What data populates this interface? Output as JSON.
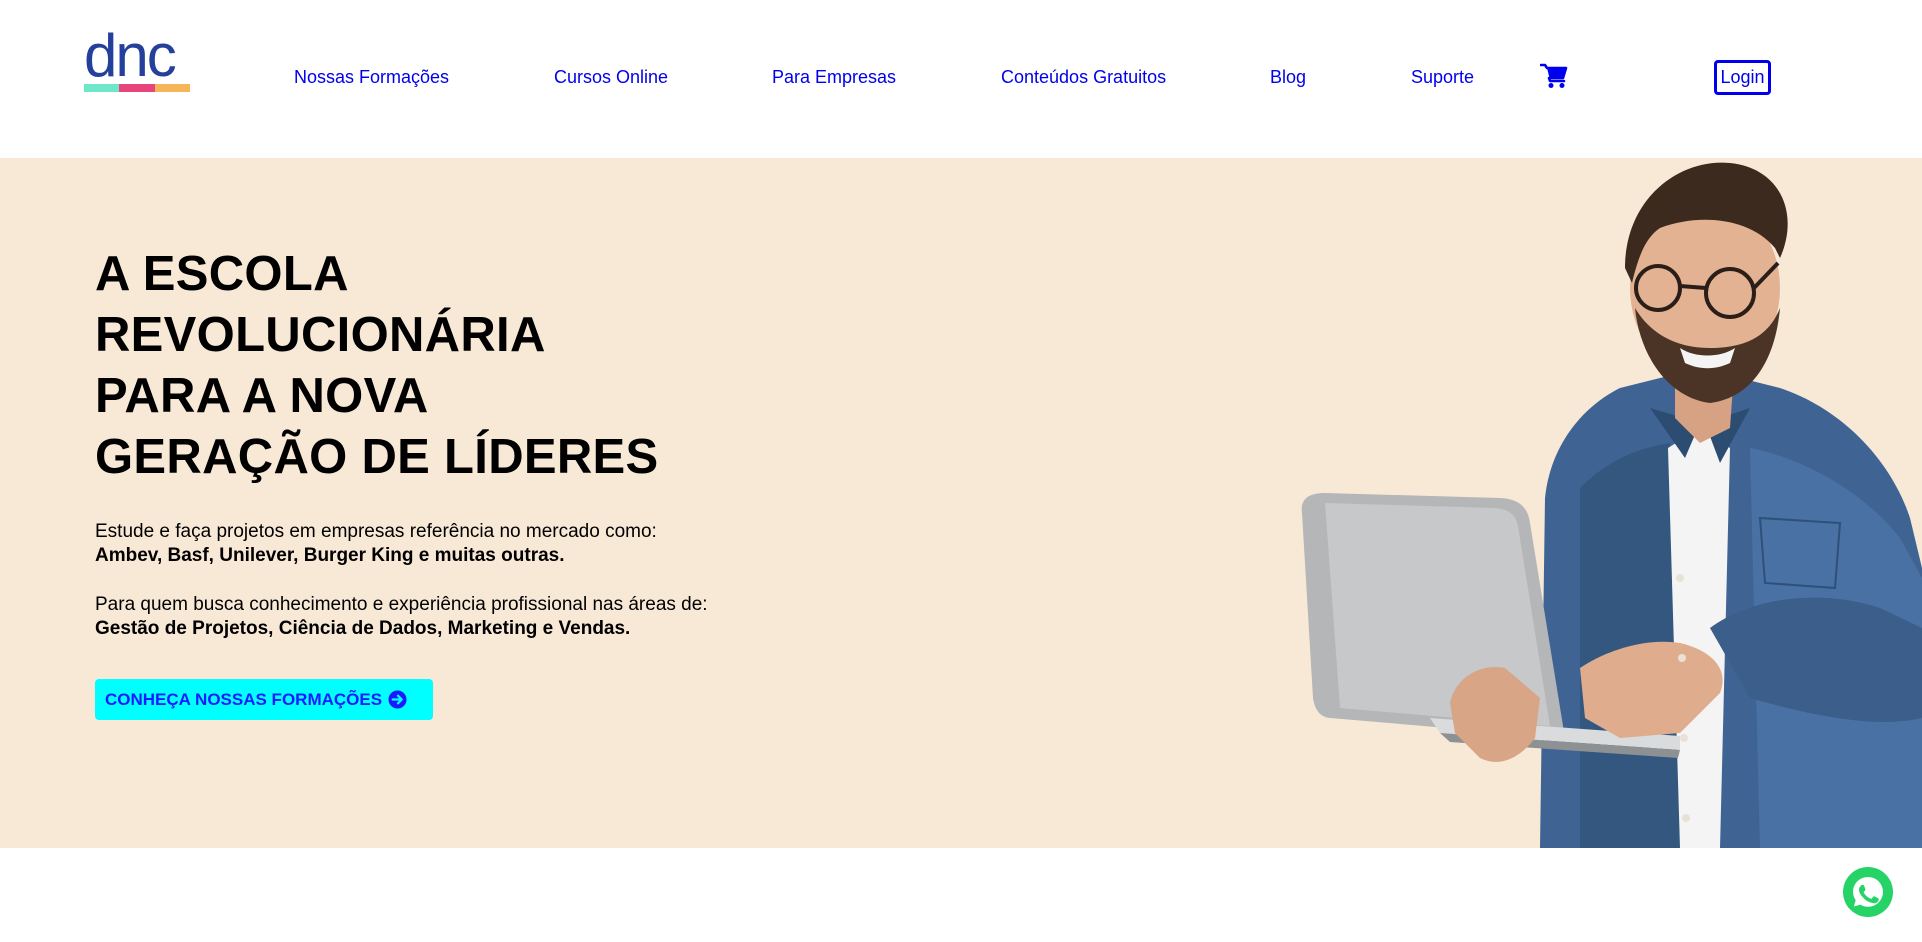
{
  "brand": {
    "logo_text": "dnc",
    "logo_color": "#24409b",
    "logo_bar_colors": [
      "#6ee7c8",
      "#e8457c",
      "#f7b55a"
    ]
  },
  "nav": {
    "items": [
      {
        "label": "Nossas Formações"
      },
      {
        "label": "Cursos Online"
      },
      {
        "label": "Para Empresas"
      },
      {
        "label": "Conteúdos Gratuitos"
      },
      {
        "label": "Blog"
      },
      {
        "label": "Suporte"
      }
    ],
    "cart_icon": "shopping-cart-icon",
    "login_label": "Login",
    "link_color": "#0000ee"
  },
  "hero": {
    "background": "#f8e9d7",
    "headline_lines": [
      "A ESCOLA",
      "REVOLUCIONÁRIA",
      "PARA A NOVA",
      "GERAÇÃO DE LÍDERES"
    ],
    "paragraph1_text": "Estude e faça projetos em empresas referência no mercado como:",
    "paragraph1_bold": "Ambev, Basf, Unilever, Burger King e muitas outras.",
    "paragraph2_text": "Para quem busca conhecimento e experiência profissional nas áreas de:",
    "paragraph2_bold": "Gestão de Projetos, Ciência de Dados, Marketing e Vendas.",
    "cta_label": "CONHEÇA NOSSAS FORMAÇÕES",
    "cta_icon": "arrow-circle-right-icon",
    "cta_background": "#00ffff"
  },
  "floating": {
    "whatsapp_icon": "whatsapp-icon",
    "whatsapp_color": "#25d366"
  }
}
